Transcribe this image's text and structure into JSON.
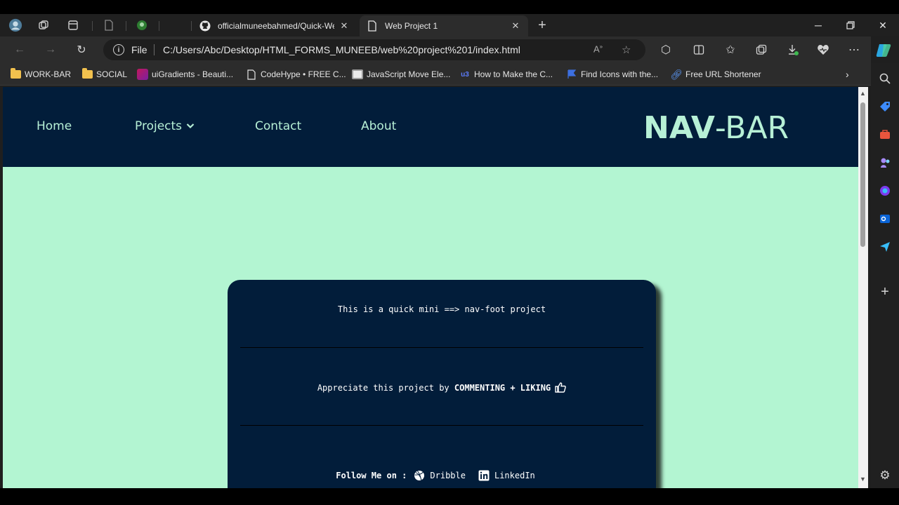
{
  "browser": {
    "tabs": [
      {
        "title": "officialmuneebahmed/Quick-Web",
        "icon": "github-icon"
      },
      {
        "title": "Web Project 1",
        "icon": "page-icon"
      }
    ],
    "address": {
      "scheme_label": "File",
      "url": "C:/Users/Abc/Desktop/HTML_FORMS_MUNEEB/web%20project%201/index.html"
    },
    "bookmarks": [
      {
        "label": "WORK-BAR"
      },
      {
        "label": "SOCIAL"
      },
      {
        "label": "uiGradients - Beauti..."
      },
      {
        "label": "CodeHype • FREE C..."
      },
      {
        "label": "JavaScript Move Ele..."
      },
      {
        "label": "How to Make the C..."
      },
      {
        "label": "Find Icons with the..."
      },
      {
        "label": "Free URL Shortener"
      }
    ]
  },
  "page": {
    "nav": {
      "links": [
        {
          "label": "Home"
        },
        {
          "label": "Projects"
        },
        {
          "label": "Contact"
        },
        {
          "label": "About"
        }
      ],
      "logo": {
        "bold": "NAV",
        "light": "-BAR"
      }
    },
    "card": {
      "intro": "This is a quick mini ==> nav-foot project",
      "appreciate_prefix": "Appreciate this project by",
      "appreciate_bold": "COMMENTING + LIKING",
      "follow_label": "Follow Me on :",
      "socials": [
        {
          "label": "Dribble",
          "icon": "dribbble-icon"
        },
        {
          "label": "LinkedIn",
          "icon": "linkedin-icon"
        }
      ]
    }
  },
  "colors": {
    "navbar_bg": "#021d3a",
    "page_bg": "#b3f5d2",
    "nav_text": "#b7f0d6"
  }
}
